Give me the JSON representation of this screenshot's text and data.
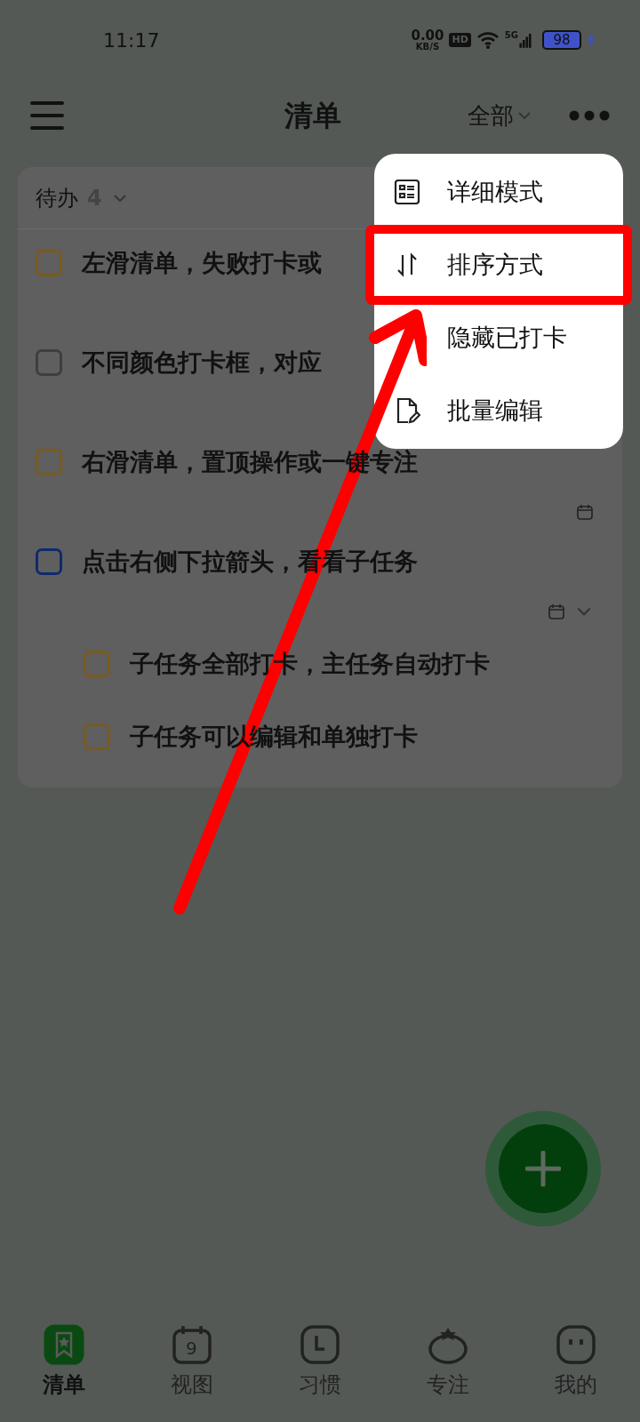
{
  "status_bar": {
    "time": "11:17",
    "net_speed": "0.00",
    "net_unit": "KB/S",
    "hd": "HD",
    "signal": "5G",
    "battery": "98"
  },
  "header": {
    "title": "清单",
    "filter": "全部"
  },
  "group": {
    "title": "待办",
    "count": "4",
    "expanded": true
  },
  "tasks": [
    {
      "text": "左滑清单，失败打卡或",
      "color": "#7a5a1e",
      "checked": false
    },
    {
      "text": "不同颜色打卡框，对应",
      "color": "#3e3e3e",
      "checked": false
    },
    {
      "text": "右滑清单，置顶操作或一键专注",
      "color": "#7a5a1e",
      "checked": false,
      "date_icon": true
    },
    {
      "text": "点击右侧下拉箭头，看看子任务",
      "color": "#0f2a6e",
      "checked": false,
      "date_icon": true,
      "expand_icon": true,
      "children": [
        {
          "text": "子任务全部打卡，主任务自动打卡",
          "color": "#7a5a1e",
          "checked": false
        },
        {
          "text": "子任务可以编辑和单独打卡",
          "color": "#7a5a1e",
          "checked": false
        }
      ]
    }
  ],
  "menu": [
    {
      "kind": "detail",
      "label": "详细模式",
      "highlighted": false
    },
    {
      "kind": "sort",
      "label": "排序方式",
      "highlighted": true
    },
    {
      "kind": "hide",
      "label": "隐藏已打卡",
      "highlighted": false
    },
    {
      "kind": "batch",
      "label": "批量编辑",
      "highlighted": false
    }
  ],
  "nav": [
    {
      "kind": "list",
      "label": "清单",
      "selected": true
    },
    {
      "kind": "calendar",
      "label": "视图",
      "selected": false,
      "icon_text": "9"
    },
    {
      "kind": "habit",
      "label": "习惯",
      "selected": false
    },
    {
      "kind": "focus",
      "label": "专注",
      "selected": false
    },
    {
      "kind": "me",
      "label": "我的",
      "selected": false
    }
  ]
}
